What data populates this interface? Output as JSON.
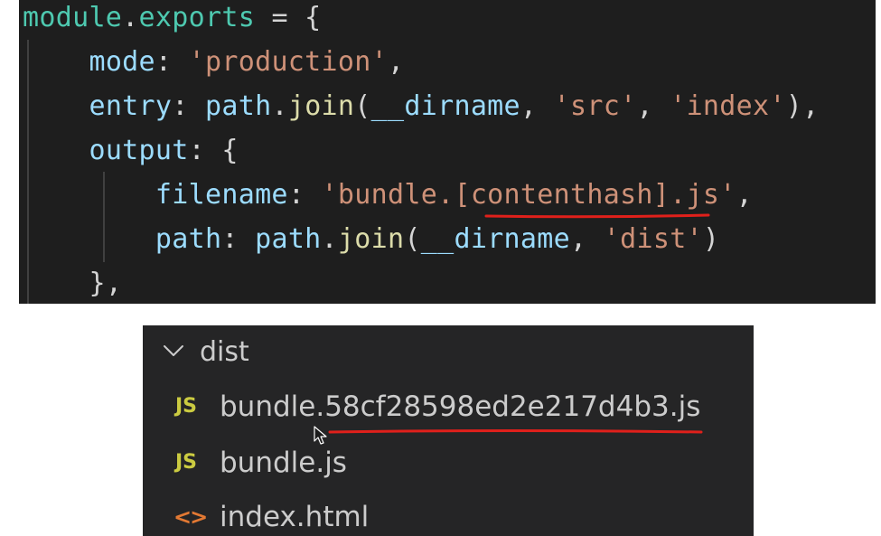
{
  "code": {
    "line1": {
      "var": "module",
      "dot": ".",
      "prop": "exports",
      "rest": " = {"
    },
    "line2": {
      "key": "mode",
      "colon": ": ",
      "value": "'production'",
      "end": ","
    },
    "line3": {
      "key": "entry",
      "colon": ": ",
      "obj": "path",
      "dot": ".",
      "fn": "join",
      "open": "(",
      "arg1": "__dirname",
      "sep1": ", ",
      "arg2": "'src'",
      "sep2": ", ",
      "arg3": "'index'",
      "close": "),"
    },
    "line4": {
      "key": "output",
      "colon": ": ",
      "brace": "{"
    },
    "line5": {
      "key": "filename",
      "colon": ": ",
      "str_a": "'bundle.",
      "str_b": "[contenthash]",
      "str_c": ".js'",
      "end": ","
    },
    "line6": {
      "key": "path",
      "colon": ": ",
      "obj": "path",
      "dot": ".",
      "fn": "join",
      "open": "(",
      "arg1": "__dirname",
      "sep1": ", ",
      "arg2": "'dist'",
      "close": ")"
    },
    "line7": {
      "text": "},"
    }
  },
  "explorer": {
    "folder": {
      "name": "dist",
      "icon": "chevron-down-icon"
    },
    "files": [
      {
        "icon_text": "JS",
        "icon": "js-file-icon",
        "name": "bundle.58cf28598ed2e217d4b3.js"
      },
      {
        "icon_text": "JS",
        "icon": "js-file-icon",
        "name": "bundle.js"
      },
      {
        "icon_text": "<>",
        "icon": "html-file-icon",
        "name": "index.html"
      }
    ]
  },
  "colors": {
    "editor_bg": "#1e1e1e",
    "explorer_bg": "#252526",
    "annotation": "#e0201b",
    "js_icon": "#cbcb41",
    "html_icon": "#e37933"
  }
}
